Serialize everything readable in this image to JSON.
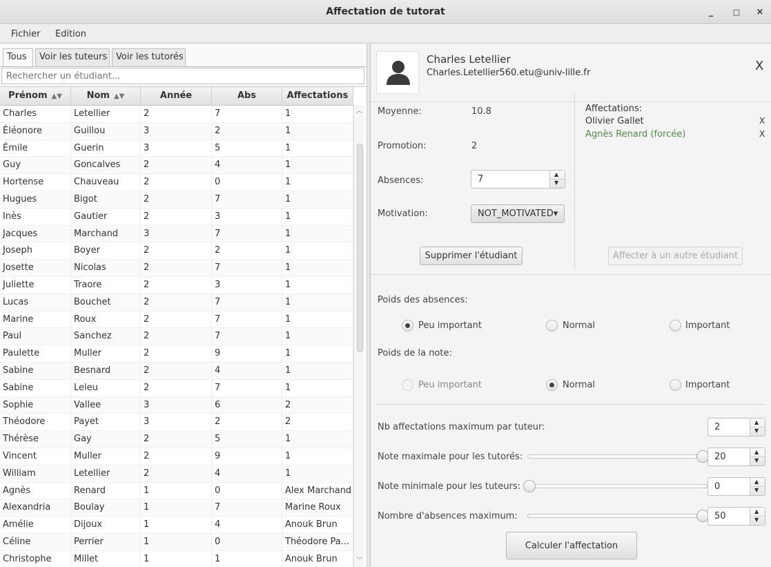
{
  "window": {
    "title": "Affectation de tutorat",
    "controls": [
      "_",
      "□",
      "×"
    ]
  },
  "menu": [
    "Fichier",
    "Edition"
  ],
  "tabs": [
    "Tous",
    "Voir les tuteurs",
    "Voir les tutorés"
  ],
  "search": {
    "placeholder": "Rechercher un étudiant..."
  },
  "table": {
    "columns": [
      "Prénom",
      "Nom",
      "Année",
      "Abs",
      "Affectations"
    ],
    "rows": [
      [
        "Charles",
        "Letellier",
        "2",
        "7",
        "1"
      ],
      [
        "Éléonore",
        "Guillou",
        "3",
        "2",
        "1"
      ],
      [
        "Émile",
        "Guerin",
        "3",
        "5",
        "1"
      ],
      [
        "Guy",
        "Goncalves",
        "2",
        "4",
        "1"
      ],
      [
        "Hortense",
        "Chauveau",
        "2",
        "0",
        "1"
      ],
      [
        "Hugues",
        "Bigot",
        "2",
        "7",
        "1"
      ],
      [
        "Inès",
        "Gautier",
        "2",
        "3",
        "1"
      ],
      [
        "Jacques",
        "Marchand",
        "3",
        "7",
        "1"
      ],
      [
        "Joseph",
        "Boyer",
        "2",
        "2",
        "1"
      ],
      [
        "Josette",
        "Nicolas",
        "2",
        "7",
        "1"
      ],
      [
        "Juliette",
        "Traore",
        "2",
        "3",
        "1"
      ],
      [
        "Lucas",
        "Bouchet",
        "2",
        "7",
        "1"
      ],
      [
        "Marine",
        "Roux",
        "2",
        "7",
        "1"
      ],
      [
        "Paul",
        "Sanchez",
        "2",
        "7",
        "1"
      ],
      [
        "Paulette",
        "Muller",
        "2",
        "9",
        "1"
      ],
      [
        "Sabine",
        "Besnard",
        "2",
        "4",
        "1"
      ],
      [
        "Sabine",
        "Leleu",
        "2",
        "7",
        "1"
      ],
      [
        "Sophie",
        "Vallee",
        "3",
        "6",
        "2"
      ],
      [
        "Théodore",
        "Payet",
        "3",
        "2",
        "2"
      ],
      [
        "Thérèse",
        "Gay",
        "2",
        "5",
        "1"
      ],
      [
        "Vincent",
        "Muller",
        "2",
        "9",
        "1"
      ],
      [
        "William",
        "Letellier",
        "2",
        "4",
        "1"
      ],
      [
        "Agnès",
        "Renard",
        "1",
        "0",
        "Alex Marchand"
      ],
      [
        "Alexandria",
        "Boulay",
        "1",
        "7",
        "Marine Roux"
      ],
      [
        "Amélie",
        "Dijoux",
        "1",
        "4",
        "Anouk Brun"
      ],
      [
        "Céline",
        "Perrier",
        "1",
        "0",
        "Théodore Pa..."
      ],
      [
        "Christophe",
        "Millet",
        "1",
        "1",
        "Anouk Brun"
      ]
    ]
  },
  "detail": {
    "name": "Charles Letellier",
    "email": "Charles.Letellier560.etu@univ-lille.fr",
    "close": "X",
    "moyenne_label": "Moyenne:",
    "moyenne": "10.8",
    "promotion_label": "Promotion:",
    "promotion": "2",
    "absences_label": "Absences:",
    "absences": "7",
    "motivation_label": "Motivation:",
    "motivation": "NOT_MOTIVATED▾",
    "delete_button": "Supprimer l'étudiant",
    "affectations_label": "Affectations:",
    "affectations": [
      {
        "name": "Olivier Gallet",
        "remove": "X",
        "color": "#333333"
      },
      {
        "name": "Agnès Renard (forcée)",
        "remove": "X",
        "color": "#4f8a43"
      }
    ],
    "assign_other_button": "Affecter à un autre étudiant"
  },
  "weights": {
    "absences_label": "Poids des absences:",
    "absences_options": [
      "Peu important",
      "Normal",
      "Important"
    ],
    "absences_selected": "Peu important",
    "note_label": "Poids de la note:",
    "note_options": [
      "Peu important",
      "Normal",
      "Important"
    ],
    "note_selected": "Normal"
  },
  "settings": {
    "max_affect_label": "Nb affectations maximum par tuteur:",
    "max_affect": "2",
    "note_max_label": "Note maximale pour les tutorés:",
    "note_max": "20",
    "note_min_label": "Note minimale pour les tuteurs:",
    "note_min": "0",
    "abs_max_label": "Nombre d'absences maximum:",
    "abs_max": "50"
  },
  "calculate_button": "Calculer l'affectation"
}
